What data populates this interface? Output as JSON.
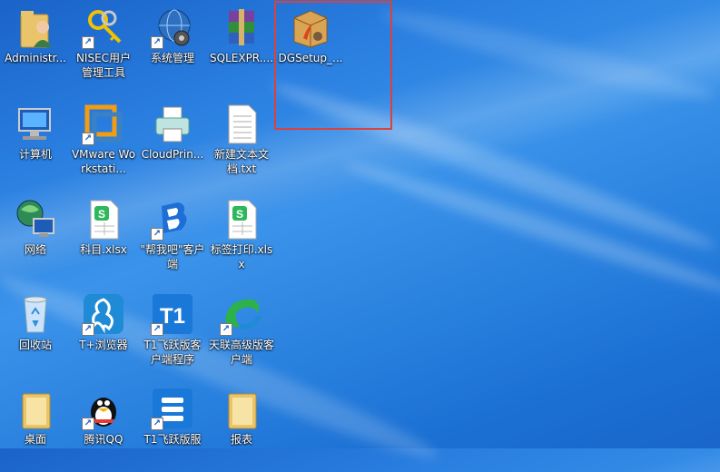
{
  "desktop": {
    "icons": [
      {
        "label": "Administr...",
        "icon": "user-folder-icon"
      },
      {
        "label": "NISEC用户管理工具",
        "icon": "keys-icon"
      },
      {
        "label": "系统管理",
        "icon": "globe-gear-icon"
      },
      {
        "label": "SQLEXPR....",
        "icon": "winrar-archive-icon"
      },
      {
        "label": "DGSetup_...",
        "icon": "package-box-icon"
      },
      {
        "label": "计算机",
        "icon": "computer-icon"
      },
      {
        "label": "VMware Workstati...",
        "icon": "vmware-icon"
      },
      {
        "label": "CloudPrin...",
        "icon": "printer-icon"
      },
      {
        "label": "新建文本文档.txt",
        "icon": "text-file-icon"
      },
      {
        "label": "网络",
        "icon": "network-icon"
      },
      {
        "label": "科目.xlsx",
        "icon": "spreadsheet-icon"
      },
      {
        "label": "\"帮我吧\"客户端",
        "icon": "bangwoba-icon"
      },
      {
        "label": "标签打印.xlsx",
        "icon": "spreadsheet-icon"
      },
      {
        "label": "回收站",
        "icon": "recycle-bin-icon"
      },
      {
        "label": "T+浏览器",
        "icon": "tplus-browser-icon"
      },
      {
        "label": "T1飞跃版客户端程序",
        "icon": "t1-app-icon"
      },
      {
        "label": "天联高级版客户端",
        "icon": "tianlian-icon"
      },
      {
        "label": "桌面",
        "icon": "folder-icon"
      },
      {
        "label": "腾讯QQ",
        "icon": "qq-penguin-icon"
      },
      {
        "label": "T1飞跃版服",
        "icon": "t1-server-icon"
      },
      {
        "label": "报表",
        "icon": "folder-icon"
      }
    ]
  },
  "colors": {
    "selection_border": "#d9423e",
    "desktop_blue": "#2a7fe0"
  }
}
